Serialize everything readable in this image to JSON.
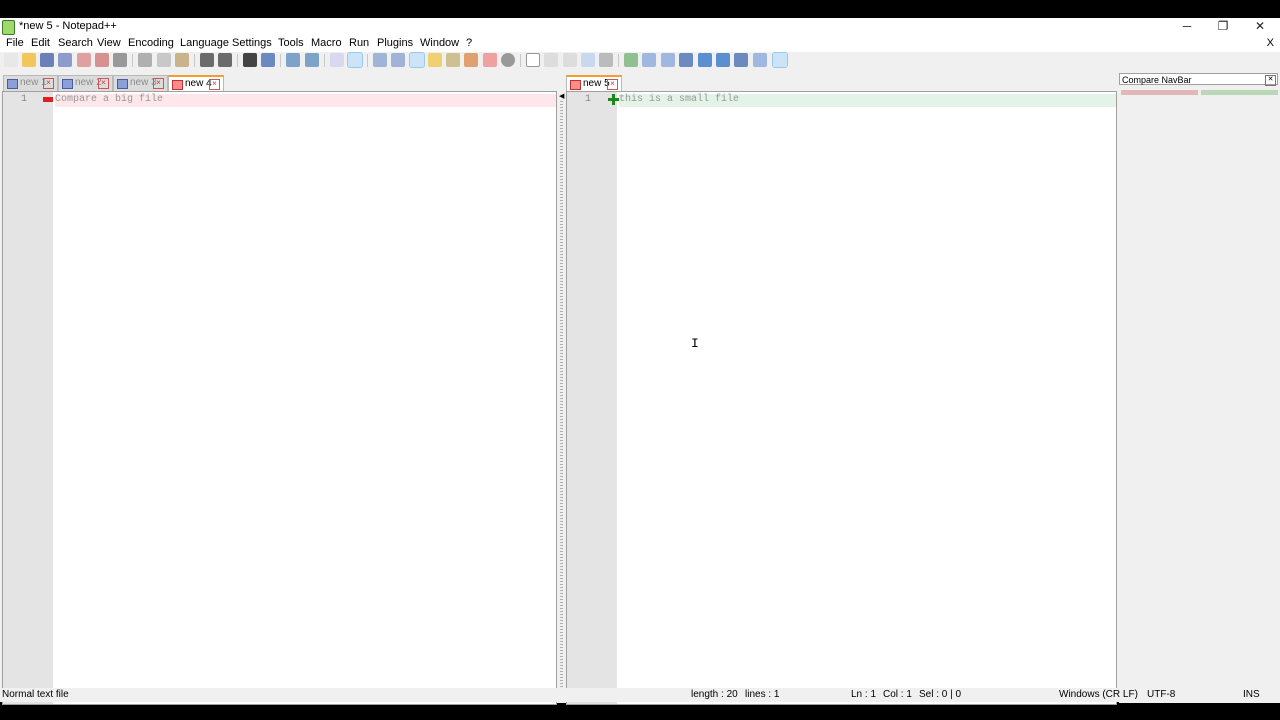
{
  "window": {
    "title": "*new 5 - Notepad++",
    "controls": {
      "minimize": "─",
      "restore": "❐",
      "close": "✕"
    }
  },
  "menu": {
    "items": [
      "File",
      "Edit",
      "Search",
      "View",
      "Encoding",
      "Language",
      "Settings",
      "Tools",
      "Macro",
      "Run",
      "Plugins",
      "Window",
      "?"
    ],
    "close_glyph": "X"
  },
  "left_pane": {
    "tabs": [
      {
        "label": "new 1",
        "active": false
      },
      {
        "label": "new 2",
        "active": false
      },
      {
        "label": "new 3",
        "active": false
      },
      {
        "label": "new 4",
        "active": true
      }
    ],
    "lines": [
      {
        "number": "1",
        "text": "Compare a big file",
        "diff": "removed"
      }
    ]
  },
  "right_pane": {
    "tabs": [
      {
        "label": "new 5",
        "active": true
      }
    ],
    "lines": [
      {
        "number": "1",
        "text": "this is a small file",
        "diff": "added"
      }
    ]
  },
  "navbar": {
    "title": "Compare NavBar",
    "close_glyph": "✕"
  },
  "colors": {
    "removed_bg": "#fde7ea",
    "added_bg": "#e3f3e8",
    "accent_tab": "#f0a030"
  },
  "status": {
    "file_type": "Normal text file",
    "length": "length : 20",
    "lines": "lines : 1",
    "ln": "Ln : 1",
    "col": "Col : 1",
    "sel": "Sel : 0 | 0",
    "eol": "Windows (CR LF)",
    "encoding": "UTF-8",
    "mode": "INS"
  },
  "icons": {
    "toolbar": [
      "new-file-icon",
      "open-file-icon",
      "save-icon",
      "save-all-icon",
      "close-icon",
      "close-all-icon",
      "print-icon",
      "cut-icon",
      "copy-icon",
      "paste-icon",
      "undo-icon",
      "redo-icon",
      "find-icon",
      "replace-icon",
      "zoom-in-icon",
      "zoom-out-icon",
      "sync-vertical-icon",
      "sync-horizontal-icon",
      "word-wrap-icon",
      "show-all-chars-icon",
      "indent-guide-icon",
      "doc-map-icon",
      "function-list-icon",
      "folder-workspace-icon",
      "doc-switcher-icon",
      "monitoring-icon",
      "record-macro-icon",
      "stop-record-icon",
      "play-macro-icon",
      "run-macro-multiple-icon",
      "save-macro-icon",
      "compare-icon",
      "clear-compare-icon",
      "navigation-bar-icon",
      "first-diff-icon",
      "prev-diff-icon",
      "next-diff-icon",
      "last-diff-icon",
      "compare-settings-icon",
      "spell-check-icon"
    ]
  }
}
